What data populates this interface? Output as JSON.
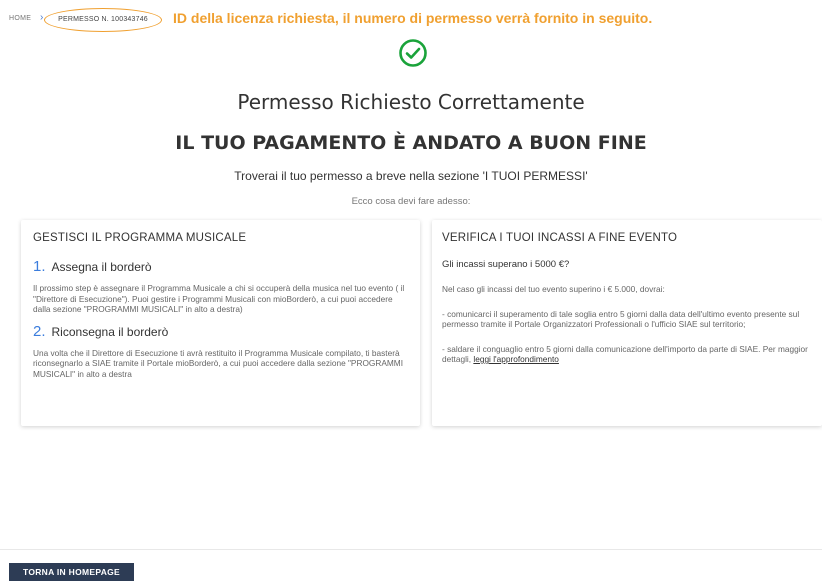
{
  "breadcrumb": {
    "home": "HOME",
    "separator": "›",
    "permit": "PERMESSO N. 100343746"
  },
  "notice": "ID della licenza richiesta, il numero di permesso verrà fornito in seguito.",
  "status": {
    "icon": "check-circle-icon",
    "title": "Permesso Richiesto Correttamente",
    "subtitle": "IL TUO PAGAMENTO È ANDATO A BUON FINE",
    "info": "Troverai il tuo permesso a breve nella sezione 'I TUOI PERMESSI'",
    "todo": "Ecco cosa devi fare adesso:"
  },
  "left_card": {
    "title": "GESTISCI IL PROGRAMMA MUSICALE",
    "steps": [
      {
        "num": "1.",
        "label": "Assegna il borderò",
        "text": "Il prossimo step è assegnare il Programma Musicale a chi si occuperà della musica nel tuo evento ( il \"Direttore di Esecuzione\"). Puoi gestire i Programmi Musicali con mioBorderò, a cui puoi accedere dalla sezione \"PROGRAMMI MUSICALI\" in alto a destra)"
      },
      {
        "num": "2.",
        "label": "Riconsegna il borderò",
        "text": "Una volta che il Direttore di Esecuzione ti avrà restituito il Programma Musicale compilato, ti basterà riconsegnarlo a SIAE tramite il Portale mioBorderò, a cui puoi accedere dalla sezione \"PROGRAMMI MUSICALI\" in alto a destra"
      }
    ]
  },
  "right_card": {
    "title": "VERIFICA I TUOI INCASSI A FINE EVENTO",
    "question": "Gli incassi superano i 5000 €?",
    "p1": "Nel caso gli incassi del tuo evento superino i € 5.000, dovrai:",
    "p2": "- comunicarci il superamento di tale soglia entro 5 giorni dalla data dell'ultimo evento presente sul permesso tramite il Portale Organizzatori Professionali o l'ufficio SIAE sul territorio;",
    "p3": "- saldare il conguaglio entro 5 giorni dalla comunicazione dell'importo da parte di SIAE. Per maggior dettagli,",
    "link": "leggi l'approfondimento"
  },
  "footer": {
    "home_button": "TORNA IN HOMEPAGE"
  },
  "colors": {
    "accent": "#3b7ddd",
    "highlight": "#f0a030",
    "success": "#1aa33a",
    "button_bg": "#2d3c55"
  }
}
